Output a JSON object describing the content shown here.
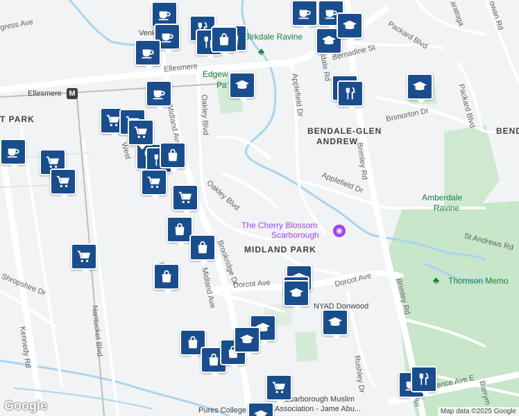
{
  "attribution": {
    "logo": "Google",
    "copyright": "Map data ©2025 Google"
  },
  "neighbourhoods": {
    "bendale_glen": "BENDALE-GLEN",
    "andrew": "ANDREW",
    "midland_park": "MIDLAND PARK",
    "t_park": "T PARK",
    "bendale_right": "BENDA"
  },
  "parks": {
    "birkdale": "Birkdale Ravine",
    "edgewood_1": "Edgew",
    "edgewood_2": "Pa",
    "amberdale_1": "Amberdale",
    "amberdale_2": "Ravine",
    "thomson": "Thomson Memo"
  },
  "transit": {
    "ellesmere_station": "Ellesmere",
    "station_symbol": "M"
  },
  "places": {
    "cherry_blossom_1": "The Cherry Blossom",
    "cherry_blossom_2": "Scarborough",
    "nyad": "NYAD Donwood",
    "venkata": "Venkata",
    "pures_college": "Pures College",
    "muslim_assoc_1": "Scarborough Muslim",
    "muslim_assoc_2": "Association - Jame Abu..."
  },
  "streets": {
    "progress": "gress Ave",
    "ellesmere_rd": "Ellesmere",
    "bernadine": "Bernadine St",
    "packard_blvd_top": "Packard Blvd",
    "packard_blvd_right": "Packard Blvd",
    "applefield_dr_upper": "Applefield Dr",
    "applefield_dr_lower": "Applefield Dr",
    "brimorton": "Brimorton Dr",
    "brimley_upper": "Brimley Rd",
    "brimley_lower": "Brimley Rd",
    "oakley_blvd_upper": "Oakley Blvd",
    "oakley_blvd_lower": "Oakley Blvd",
    "midland_upper": "Midland Ave",
    "midland_lower": "Midland Ave",
    "brookridge": "Brookridge Dr",
    "dorcot_left": "Dorcot Ave",
    "dorcot_right": "Dorcot Ave",
    "st_andrews": "St Andrews Rd",
    "kennedy": "Kennedy Rd",
    "nantucket": "Nantucket Blvd",
    "shropshire": "Shropshire Dr",
    "rushley": "Rushley Dr",
    "lawrence": "rence Ave E",
    "birkdale_rd": "Birkdale Rd",
    "m_rd": "M d",
    "saratoga": "aratoga",
    "rowan": "owan Rd",
    "barrymore": "Barrym",
    "brimley_short": "Bri",
    "west_frag": "West"
  },
  "markers": [
    {
      "kind": "coffee",
      "name": "coffee-marker"
    },
    {
      "kind": "shopping-cart",
      "name": "grocery-marker"
    },
    {
      "kind": "shopping-bag",
      "name": "shopping-marker"
    },
    {
      "kind": "restaurant",
      "name": "restaurant-marker"
    },
    {
      "kind": "school",
      "name": "school-marker"
    }
  ],
  "colors": {
    "marker_fill": "#1a4d8c",
    "park_green": "#c8e6c9",
    "water": "#a8d4f0",
    "road_major": "#ffffff",
    "rail": "#bdbdbd",
    "poi_purple": "#a142f4"
  }
}
